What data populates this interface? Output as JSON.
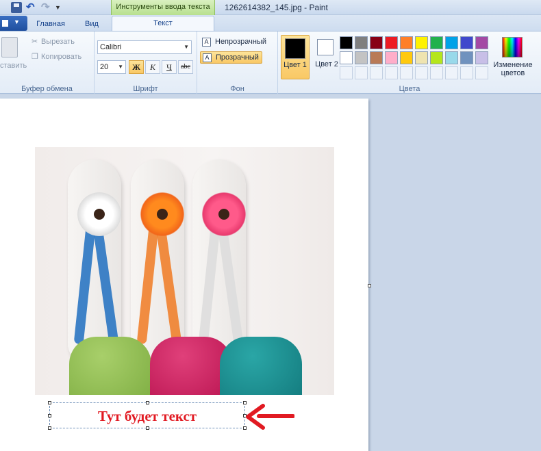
{
  "titlebar": {
    "context_tab_header": "Инструменты ввода текста",
    "window_title": "1262614382_145.jpg - Paint"
  },
  "tabs": [
    {
      "label": "Главная"
    },
    {
      "label": "Вид"
    },
    {
      "label": "Текст"
    }
  ],
  "clipboard": {
    "paste_label": "ставить",
    "cut_label": "Вырезать",
    "copy_label": "Копировать",
    "group_label": "Буфер обмена"
  },
  "font": {
    "family": "Calibri",
    "size": "20",
    "bold_label": "Ж",
    "italic_label": "К",
    "underline_label": "Ч",
    "strike_label": "abc",
    "group_label": "Шрифт"
  },
  "background": {
    "opaque_label": "Непрозрачный",
    "transparent_label": "Прозрачный",
    "selected": "Прозрачный",
    "group_label": "Фон"
  },
  "colors": {
    "color1_label": "Цвет 1",
    "color2_label": "Цвет 2",
    "color1_value": "#000000",
    "color2_value": "#ffffff",
    "edit_label": "Изменение цветов",
    "group_label": "Цвета",
    "palette": [
      [
        "#000000",
        "#7f7f7f",
        "#880015",
        "#ed1c24",
        "#ff7f27",
        "#fff200",
        "#22b14c",
        "#00a2e8",
        "#3f48cc",
        "#a349a4"
      ],
      [
        "#ffffff",
        "#c3c3c3",
        "#b97a57",
        "#ffaec9",
        "#ffc90e",
        "#efe4b0",
        "#b5e61d",
        "#99d9ea",
        "#7092be",
        "#c8bfe7"
      ],
      [
        "#eef3fa",
        "#eef3fa",
        "#eef3fa",
        "#eef3fa",
        "#eef3fa",
        "#eef3fa",
        "#eef3fa",
        "#eef3fa",
        "#eef3fa",
        "#eef3fa"
      ]
    ]
  },
  "canvas": {
    "text": "Тут будет текст",
    "text_color": "#e11a22",
    "arrow_color": "#e11a22"
  }
}
